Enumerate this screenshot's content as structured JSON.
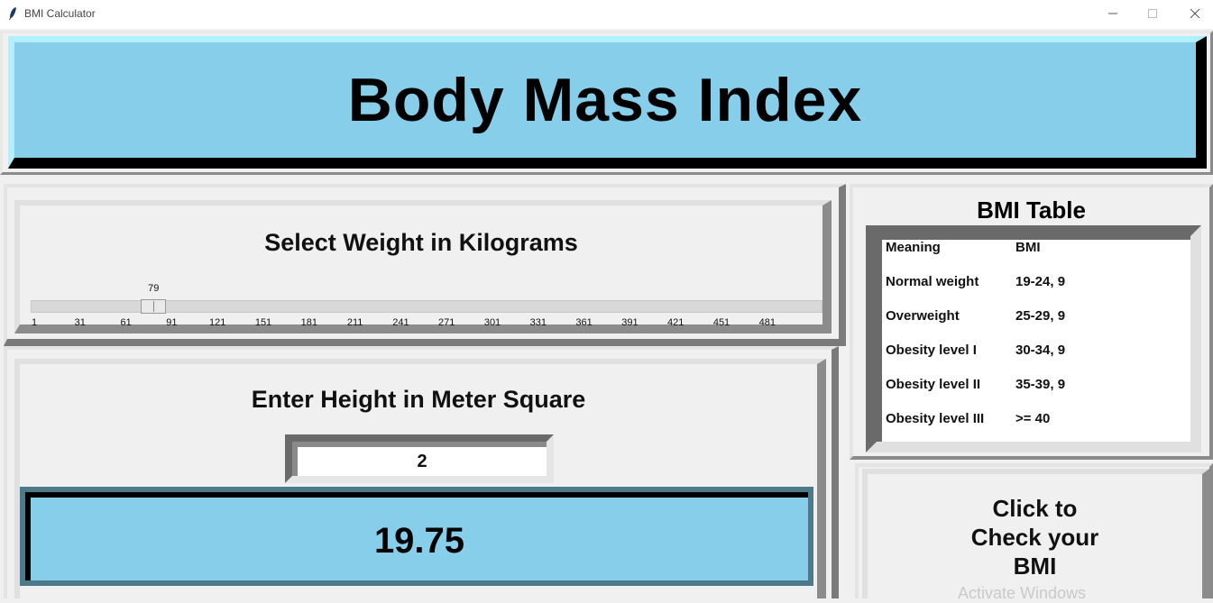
{
  "window": {
    "title": "BMI Calculator"
  },
  "header": {
    "title": "Body Mass Index"
  },
  "weight": {
    "label": "Select Weight in Kilograms",
    "value": "79",
    "value_num": 79,
    "min": 1,
    "max": 500,
    "ticks": [
      "1",
      "31",
      "61",
      "91",
      "121",
      "151",
      "181",
      "211",
      "241",
      "271",
      "301",
      "331",
      "361",
      "391",
      "421",
      "451",
      "481"
    ]
  },
  "height": {
    "label": "Enter Height in Meter Square",
    "value": "2"
  },
  "result": {
    "value": "19.75"
  },
  "bmi_table": {
    "title": "BMI Table",
    "rows": [
      {
        "meaning": "Meaning",
        "bmi": "BMI"
      },
      {
        "meaning": "Normal weight",
        "bmi": "19-24, 9"
      },
      {
        "meaning": "Overweight",
        "bmi": "25-29, 9"
      },
      {
        "meaning": "Obesity level I",
        "bmi": "30-34, 9"
      },
      {
        "meaning": "Obesity level II",
        "bmi": "35-39, 9"
      },
      {
        "meaning": "Obesity level III",
        "bmi": ">= 40"
      }
    ]
  },
  "check_button": {
    "label": "Click to\nCheck your\nBMI"
  },
  "watermark": "Activate Windows"
}
